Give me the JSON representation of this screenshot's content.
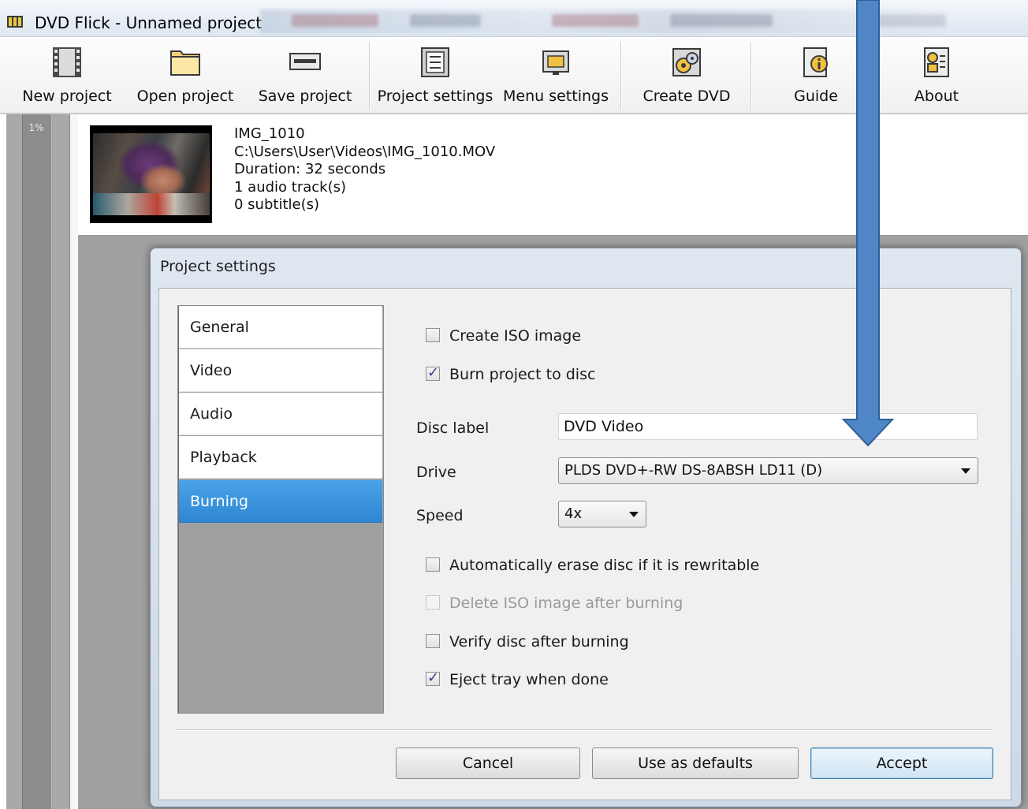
{
  "window": {
    "title": "DVD Flick - Unnamed project"
  },
  "toolbar": {
    "items": [
      {
        "label": "New project",
        "icon": "film-strip-icon"
      },
      {
        "label": "Open project",
        "icon": "folder-icon"
      },
      {
        "label": "Save project",
        "icon": "disk-drive-icon"
      },
      {
        "label": "Project settings",
        "icon": "settings-sheet-icon"
      },
      {
        "label": "Menu settings",
        "icon": "menu-screen-icon"
      },
      {
        "label": "Create DVD",
        "icon": "disc-gears-icon"
      },
      {
        "label": "Guide",
        "icon": "info-book-icon"
      },
      {
        "label": "About",
        "icon": "about-document-icon"
      }
    ]
  },
  "progress": {
    "percent": "1%"
  },
  "video": {
    "name": "IMG_1010",
    "path": "C:\\Users\\User\\Videos\\IMG_1010.MOV",
    "duration": "Duration: 32 seconds",
    "audio": "1 audio track(s)",
    "subtitles": "0 subtitle(s)"
  },
  "dialog": {
    "title": "Project settings",
    "categories": [
      {
        "label": "General"
      },
      {
        "label": "Video"
      },
      {
        "label": "Audio"
      },
      {
        "label": "Playback"
      },
      {
        "label": "Burning"
      }
    ],
    "selected_category": "Burning",
    "burning": {
      "create_iso": {
        "label": "Create ISO image",
        "checked": false
      },
      "burn_to_disc": {
        "label": "Burn project to disc",
        "checked": true
      },
      "disc_label": {
        "label": "Disc label",
        "value": "DVD Video"
      },
      "drive": {
        "label": "Drive",
        "value": "PLDS DVD+-RW DS-8ABSH LD11 (D)"
      },
      "speed": {
        "label": "Speed",
        "value": "4x"
      },
      "auto_erase": {
        "label": "Automatically erase disc if it is rewritable",
        "checked": false
      },
      "delete_iso": {
        "label": "Delete ISO image after burning",
        "checked": false,
        "disabled": true
      },
      "verify": {
        "label": "Verify disc after burning",
        "checked": false
      },
      "eject": {
        "label": "Eject tray when done",
        "checked": true
      }
    },
    "buttons": {
      "cancel": "Cancel",
      "defaults": "Use as defaults",
      "accept": "Accept"
    }
  },
  "colors": {
    "selection": "#2f86d2",
    "arrow_fill": "#4f86c6",
    "arrow_stroke": "#2f5f95"
  }
}
